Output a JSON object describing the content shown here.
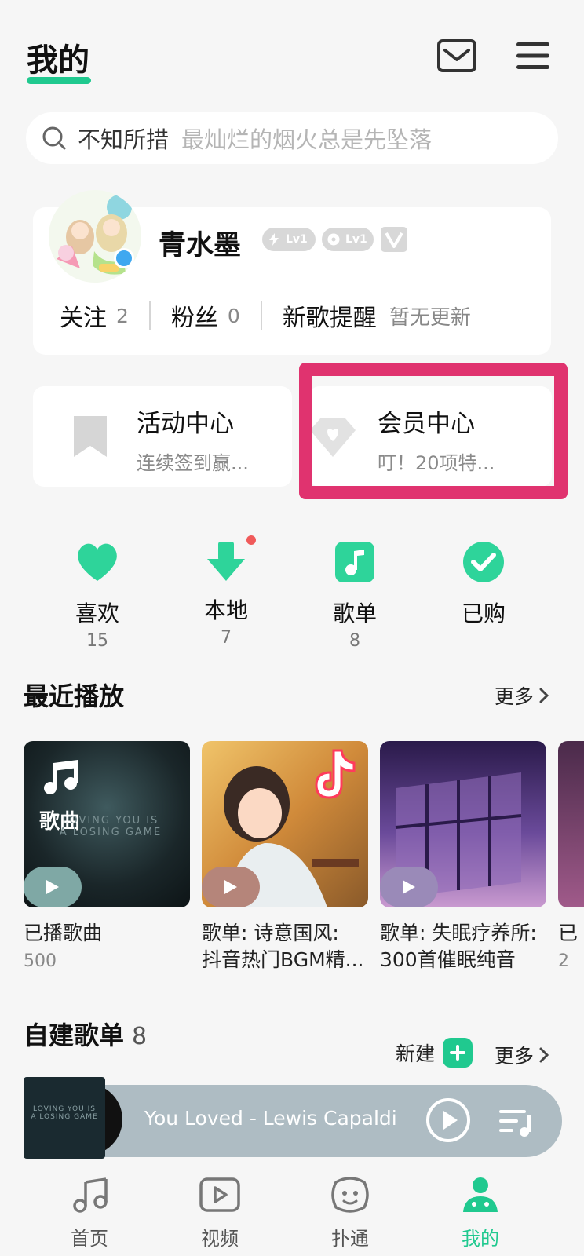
{
  "header": {
    "title": "我的"
  },
  "search": {
    "query": "不知所措",
    "hint": "最灿烂的烟火总是先坠落"
  },
  "profile": {
    "username": "青水墨",
    "badges": [
      "Lv1",
      "Lv1"
    ],
    "stats": {
      "follow_label": "关注",
      "follow_count": "2",
      "fans_label": "粉丝",
      "fans_count": "0",
      "newsong_label": "新歌提醒",
      "newsong_note": "暂无更新"
    }
  },
  "cards": {
    "activity": {
      "title": "活动中心",
      "subtitle": "连续签到赢..."
    },
    "vip": {
      "title": "会员中心",
      "subtitle": "叮！20项特..."
    }
  },
  "quick_actions": [
    {
      "label": "喜欢",
      "count": "15"
    },
    {
      "label": "本地",
      "count": "7"
    },
    {
      "label": "歌单",
      "count": "8"
    },
    {
      "label": "已购",
      "count": ""
    }
  ],
  "recent": {
    "title": "最近播放",
    "more": "更多",
    "items": [
      {
        "title": "已播歌曲",
        "sub": "500",
        "cover_tag": "歌曲",
        "cover_text": "LOVING YOU IS\nA LOSING GAME",
        "color": "#1f2a2e"
      },
      {
        "title": "歌单: 诗意国风:\n抖音热门BGM精...",
        "sub": "",
        "color": "#d9a24a"
      },
      {
        "title": "歌单: 失眠疗养所:\n300首催眠纯音",
        "sub": "",
        "color": "#3a2a5e"
      },
      {
        "title": "已",
        "sub": "2",
        "color": "#6a3a5e"
      }
    ]
  },
  "playlists": {
    "title": "自建歌单",
    "count": "8",
    "new_label": "新建",
    "more": "更多"
  },
  "player": {
    "song": "You Loved - Lewis Capaldi",
    "cover_text": "LOVING YOU IS\nA LOSING GAME"
  },
  "nav": [
    {
      "label": "首页",
      "icon": "music-note-icon"
    },
    {
      "label": "视频",
      "icon": "video-play-icon"
    },
    {
      "label": "扑通",
      "icon": "face-icon"
    },
    {
      "label": "我的",
      "icon": "profile-icon",
      "active": true
    }
  ],
  "colors": {
    "accent": "#20c98f",
    "highlight": "#e0336f",
    "badge_red": "#f05a5a"
  }
}
